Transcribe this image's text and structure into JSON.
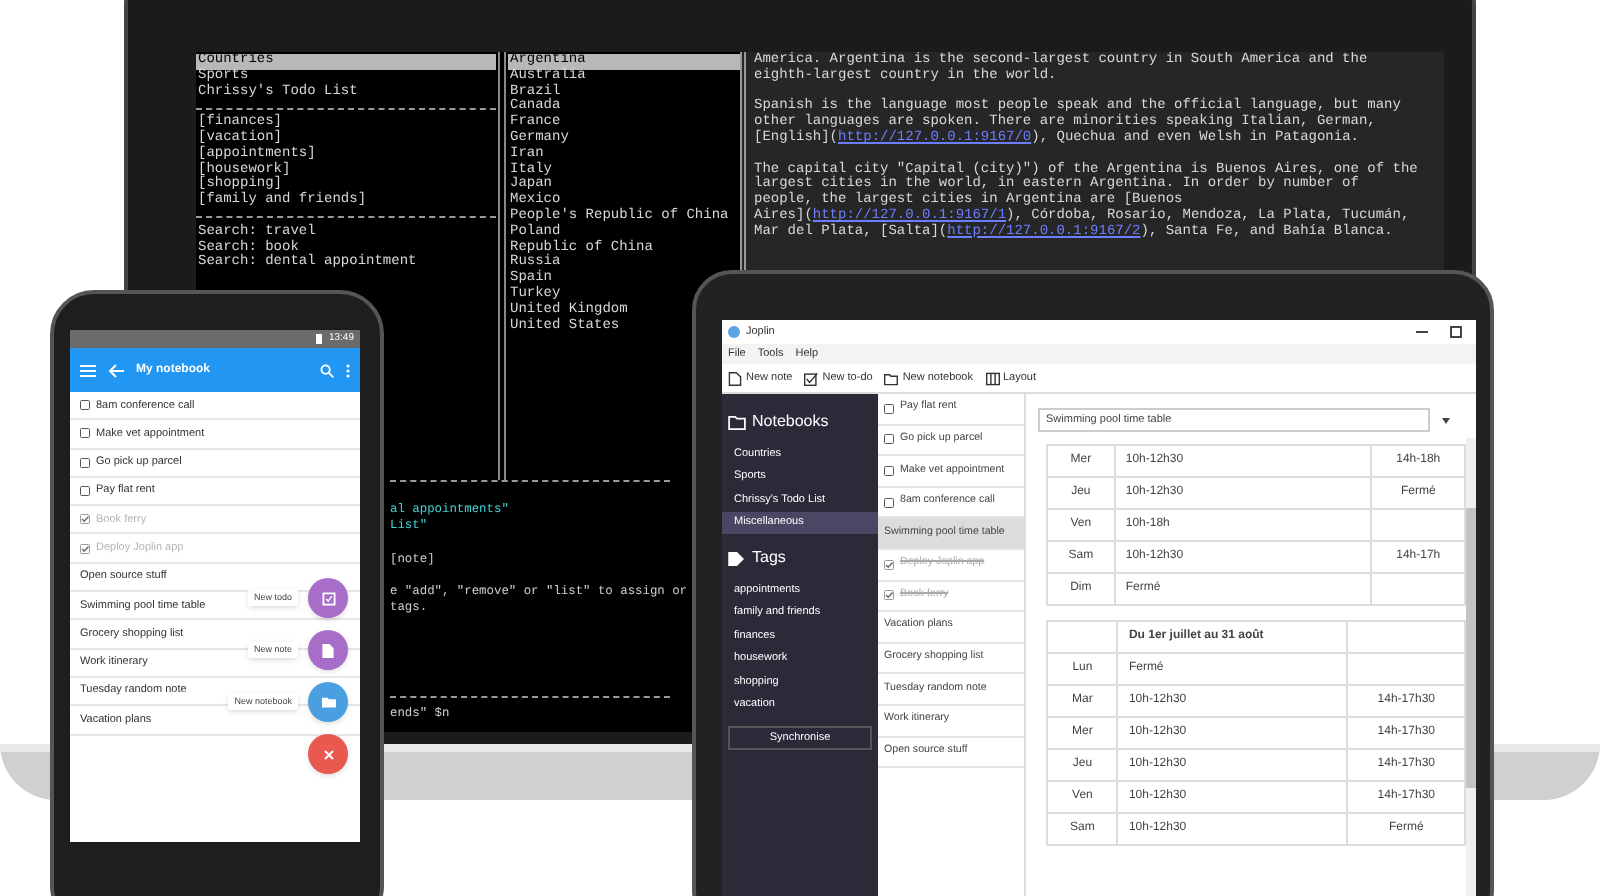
{
  "terminal": {
    "left_pane": [
      {
        "text": "Countries",
        "kind": "notebook",
        "selected": true
      },
      {
        "text": "Sports",
        "kind": "notebook",
        "selected": false
      },
      {
        "text": "Chrissy's Todo List",
        "kind": "notebook",
        "selected": false
      },
      {
        "text": "[finances]",
        "kind": "tag",
        "selected": false
      },
      {
        "text": "[vacation]",
        "kind": "tag",
        "selected": false
      },
      {
        "text": "[appointments]",
        "kind": "tag",
        "selected": false
      },
      {
        "text": "[housework]",
        "kind": "tag",
        "selected": false
      },
      {
        "text": "[shopping]",
        "kind": "tag",
        "selected": false
      },
      {
        "text": "[family and friends]",
        "kind": "tag",
        "selected": false
      },
      {
        "text": "Search: travel",
        "kind": "search",
        "selected": false
      },
      {
        "text": "Search: book",
        "kind": "search",
        "selected": false
      },
      {
        "text": "Search: dental appointment",
        "kind": "search",
        "selected": false
      }
    ],
    "countries": [
      {
        "name": "Argentina",
        "selected": true
      },
      {
        "name": "Australia",
        "selected": false
      },
      {
        "name": "Brazil",
        "selected": false
      },
      {
        "name": "Canada",
        "selected": false
      },
      {
        "name": "France",
        "selected": false
      },
      {
        "name": "Germany",
        "selected": false
      },
      {
        "name": "Iran",
        "selected": false
      },
      {
        "name": "Italy",
        "selected": false
      },
      {
        "name": "Japan",
        "selected": false
      },
      {
        "name": "Mexico",
        "selected": false
      },
      {
        "name": "People's Republic of China",
        "selected": false
      },
      {
        "name": "Poland",
        "selected": false
      },
      {
        "name": "Republic of China",
        "selected": false
      },
      {
        "name": "Russia",
        "selected": false
      },
      {
        "name": "Spain",
        "selected": false
      },
      {
        "name": "Turkey",
        "selected": false
      },
      {
        "name": "United Kingdom",
        "selected": false
      },
      {
        "name": "United States",
        "selected": false
      }
    ],
    "note_paragraphs": [
      [
        [
          {
            "text": "America. Argentina is the second-largest country in South America and the",
            "kind": "text"
          }
        ],
        [
          {
            "text": "eighth-largest country in the world.",
            "kind": "text"
          }
        ]
      ],
      [
        [
          {
            "text": "Spanish is the language most people speak and the official language, but many",
            "kind": "text"
          }
        ],
        [
          {
            "text": "other languages are spoken. There are minorities speaking Italian, German,",
            "kind": "text"
          }
        ],
        [
          {
            "text": "[English](",
            "kind": "text"
          },
          {
            "text": "http://127.0.0.1:9167/0",
            "kind": "link"
          },
          {
            "text": "), Quechua and even Welsh in Patagonia.",
            "kind": "text"
          }
        ]
      ],
      [
        [
          {
            "text": "The capital city \"Capital (city)\") of the Argentina is Buenos Aires, one of the",
            "kind": "text"
          }
        ],
        [
          {
            "text": "largest cities in the world, in eastern Argentina. In order by number of",
            "kind": "text"
          }
        ],
        [
          {
            "text": "people, the largest cities in Argentina are [Buenos",
            "kind": "text"
          }
        ],
        [
          {
            "text": "Aires](",
            "kind": "text"
          },
          {
            "text": "http://127.0.0.1:9167/1",
            "kind": "link"
          },
          {
            "text": "), Córdoba, Rosario, Mendoza, La Plata, Tucumán,",
            "kind": "text"
          }
        ],
        [
          {
            "text": "Mar del Plata, [Salta](",
            "kind": "text"
          },
          {
            "text": "http://127.0.0.1:9167/2",
            "kind": "link"
          },
          {
            "text": "), Santa Fe, and Bahía Blanca.",
            "kind": "text"
          }
        ]
      ]
    ],
    "command_lines": [
      {
        "text": "al appointments\"",
        "kind": "highlight"
      },
      {
        "text": "List\"",
        "kind": "highlight"
      },
      {
        "text": "[note]",
        "kind": "option"
      },
      {
        "text": "e \"add\", \"remove\" or \"list\" to assign or",
        "kind": "help"
      },
      {
        "text": "tags.",
        "kind": "help"
      },
      {
        "text": "ends\" $n",
        "kind": "prompt"
      }
    ]
  },
  "phone": {
    "time": "13:49",
    "title": "My notebook",
    "notes": [
      {
        "title": "8am conference call",
        "kind": "todo",
        "checked": false
      },
      {
        "title": "Make vet appointment",
        "kind": "todo",
        "checked": false
      },
      {
        "title": "Go pick up parcel",
        "kind": "todo",
        "checked": false
      },
      {
        "title": "Pay flat rent",
        "kind": "todo",
        "checked": false
      },
      {
        "title": "Book ferry",
        "kind": "todo",
        "checked": true
      },
      {
        "title": "Deploy Joplin app",
        "kind": "todo",
        "checked": true
      },
      {
        "title": "Open source stuff",
        "kind": "note"
      },
      {
        "title": "Swimming pool time table",
        "kind": "note"
      },
      {
        "title": "Grocery shopping list",
        "kind": "note"
      },
      {
        "title": "Work itinerary",
        "kind": "note"
      },
      {
        "title": "Tuesday random note",
        "kind": "note"
      },
      {
        "title": "Vacation plans",
        "kind": "note"
      }
    ],
    "actions": [
      {
        "label": "New todo",
        "kind": "todo",
        "color": "#a86cc9"
      },
      {
        "label": "New note",
        "kind": "note",
        "color": "#a86cc9"
      },
      {
        "label": "New notebook",
        "kind": "notebook",
        "color": "#4a9fe0"
      },
      {
        "kind": "close",
        "color": "#e85a4f"
      }
    ]
  },
  "tablet": {
    "title": "Joplin",
    "menu": [
      "File",
      "Tools",
      "Help"
    ],
    "toolbar": [
      {
        "label": "New note",
        "kind": "note"
      },
      {
        "label": "New to-do",
        "kind": "todo"
      },
      {
        "label": "New notebook",
        "kind": "notebook"
      },
      {
        "label": "Layout",
        "kind": "layout"
      }
    ],
    "notebooks_heading": "Notebooks",
    "notebooks": [
      {
        "name": "Countries",
        "selected": false
      },
      {
        "name": "Sports",
        "selected": false
      },
      {
        "name": "Chrissy's Todo List",
        "selected": false
      },
      {
        "name": "Miscellaneous",
        "selected": true
      }
    ],
    "tags_heading": "Tags",
    "tags": [
      "appointments",
      "family and friends",
      "finances",
      "housework",
      "shopping",
      "vacation"
    ],
    "sync_button": "Synchronise",
    "notes": [
      {
        "title": "Pay flat rent",
        "kind": "todo",
        "checked": false,
        "selected": false
      },
      {
        "title": "Go pick up parcel",
        "kind": "todo",
        "checked": false,
        "selected": false
      },
      {
        "title": "Make vet appointment",
        "kind": "todo",
        "checked": false,
        "selected": false
      },
      {
        "title": "8am conference call",
        "kind": "todo",
        "checked": false,
        "selected": false
      },
      {
        "title": "Swimming pool time table",
        "kind": "note",
        "selected": true
      },
      {
        "title": "Deploy Joplin app",
        "kind": "todo",
        "checked": true,
        "selected": false
      },
      {
        "title": "Book ferry",
        "kind": "todo",
        "checked": true,
        "selected": false
      },
      {
        "title": "Vacation plans",
        "kind": "note",
        "selected": false
      },
      {
        "title": "Grocery shopping list",
        "kind": "note",
        "selected": false
      },
      {
        "title": "Tuesday random note",
        "kind": "note",
        "selected": false
      },
      {
        "title": "Work itinerary",
        "kind": "note",
        "selected": false
      },
      {
        "title": "Open source stuff",
        "kind": "note",
        "selected": false
      }
    ],
    "note_title": "Swimming pool time table",
    "tables": [
      {
        "rows": [
          {
            "column_1": "Mer",
            "column_2": "10h-12h30",
            "column_3": "14h-18h"
          },
          {
            "column_1": "Jeu",
            "column_2": "10h-12h30",
            "column_3": "Fermé"
          },
          {
            "column_1": "Ven",
            "column_2": "10h-18h"
          },
          {
            "column_1": "Sam",
            "column_2": "10h-12h30",
            "column_3": "14h-17h"
          },
          {
            "column_1": "Dim",
            "column_2": "Fermé"
          }
        ]
      },
      {
        "header": {
          "column_2": "Du 1er juillet au 31 août"
        },
        "rows": [
          {
            "column_1": "Lun",
            "column_2": "Fermé"
          },
          {
            "column_1": "Mar",
            "column_2": "10h-12h30",
            "column_3": "14h-17h30"
          },
          {
            "column_1": "Mer",
            "column_2": "10h-12h30",
            "column_3": "14h-17h30"
          },
          {
            "column_1": "Jeu",
            "column_2": "10h-12h30",
            "column_3": "14h-17h30"
          },
          {
            "column_1": "Ven",
            "column_2": "10h-12h30",
            "column_3": "14h-17h30"
          },
          {
            "column_1": "Sam",
            "column_2": "10h-12h30",
            "column_3": "Fermé"
          }
        ]
      }
    ]
  }
}
